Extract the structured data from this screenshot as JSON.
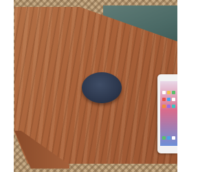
{
  "scene": {
    "subject": "wireless-charger",
    "colors": {
      "table_wood": "#a96139",
      "wicker": "#c7ab86",
      "cushion": "#4b6a66",
      "charger": "#2c374d",
      "phone_body": "#f2f2f2"
    }
  }
}
